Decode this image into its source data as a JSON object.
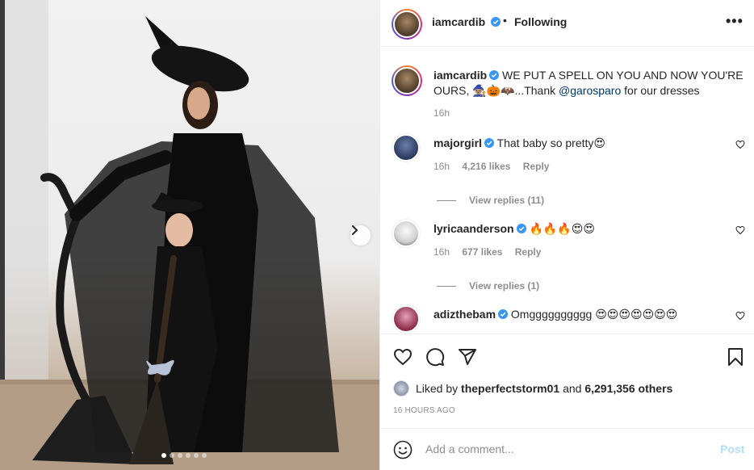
{
  "post": {
    "slide_count": 6,
    "active_slide": 1
  },
  "header": {
    "username": "iamcardib",
    "separator": "•",
    "follow_status": "Following",
    "more": "•••"
  },
  "caption": {
    "username": "iamcardib",
    "text_before_mention": "WE PUT A SPELL ON YOU AND NOW YOU'RE OURS, 🧙🏽🎃🦇...Thank",
    "mention": "@garosparo",
    "text_after_mention": "for our dresses",
    "time": "16h"
  },
  "comments": [
    {
      "username": "majorgirl",
      "text": "That baby so pretty😍",
      "time": "16h",
      "likes": "4,216 likes",
      "reply": "Reply",
      "view_replies": "View replies (11)"
    },
    {
      "username": "lyricaanderson",
      "text": "🔥🔥🔥😍😍",
      "time": "16h",
      "likes": "677 likes",
      "reply": "Reply",
      "view_replies": "View replies (1)"
    },
    {
      "username": "adizthebam",
      "text": "Omgggggggggg 😍😍😍😍😍😍😍"
    }
  ],
  "likes": {
    "prefix": "Liked by",
    "user": "theperfectstorm01",
    "conj": "and",
    "others": "6,291,356 others"
  },
  "time_ago": "16 HOURS AGO",
  "add_comment": {
    "placeholder": "Add a comment...",
    "post_label": "Post"
  },
  "colors": {
    "verified": "#3897f0",
    "post_disabled": "#b2dffc",
    "link": "#00376b"
  }
}
